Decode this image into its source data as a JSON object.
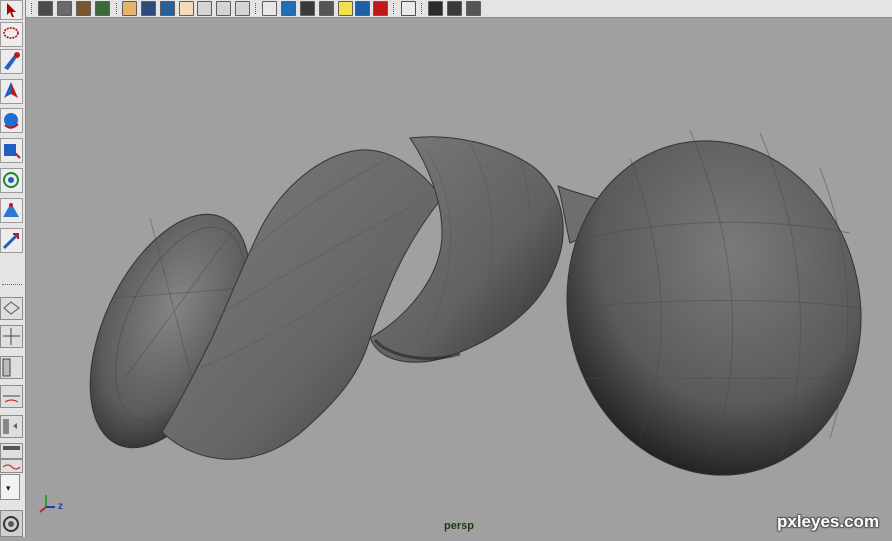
{
  "viewport": {
    "camera_label": "persp",
    "axis_label": "z",
    "watermark": "pxleyes.com"
  },
  "colors": {
    "ui_panel": "#e4e4e4",
    "viewport_bg": "#a0a0a0",
    "mesh_gray": "#6b6b6b",
    "camera_label": "#1e3a14",
    "axis_x": "#c62828",
    "axis_y": "#2e9e2e",
    "axis_z": "#1c3ea8"
  },
  "toolbar": {
    "icons": [
      "select-tool-icon",
      "render-settings-icon",
      "render-view-icon",
      "hypershade-icon",
      "ipr-render-icon",
      "grid-toggle-icon",
      "film-gate-icon",
      "resolution-gate-icon",
      "sphere-shade-icon",
      "wireframe-icon",
      "xray-icon",
      "texture-icon",
      "cube-wireframe-icon",
      "cube-smooth-icon",
      "cube-flat-icon",
      "cube-textured-icon",
      "light-bulb-icon",
      "shadows-icon",
      "red-cube-icon",
      "isolate-select-icon",
      "camera-icon",
      "viewport-layout-icon",
      "pen-curve-icon"
    ]
  },
  "toolbox": {
    "tools": [
      "select-arrow-icon",
      "lasso-icon",
      "paint-select-icon",
      "move-tool-icon",
      "rotate-tool-icon",
      "scale-tool-icon",
      "universal-manipulator-icon",
      "soft-mod-icon",
      "show-manipulator-icon"
    ],
    "layouts": [
      "single-pane-layout-icon",
      "four-pane-layout-icon",
      "two-pane-side-layout-icon",
      "two-pane-stacked-layout-icon",
      "graph-layout-icon",
      "outliner-layout-icon",
      "hypershade-layout-icon"
    ],
    "dropdown_value": "▾"
  }
}
